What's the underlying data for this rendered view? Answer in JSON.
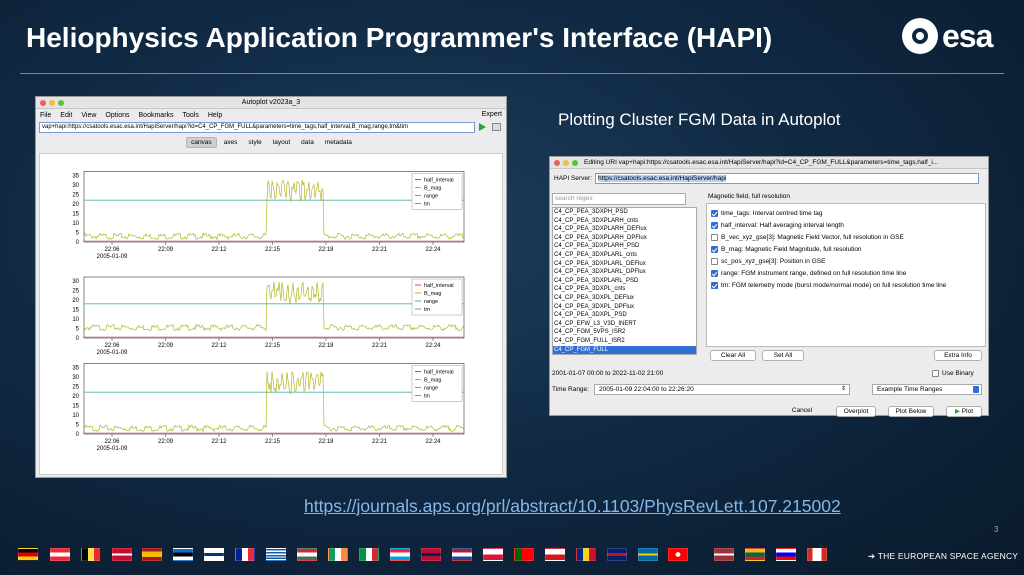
{
  "slide": {
    "title": "Heliophysics Application Programmer's Interface (HAPI)",
    "logo_text": "esa",
    "caption": "Plotting Cluster FGM Data in Autoplot",
    "link": "https://journals.aps.org/prl/abstract/10.1103/PhysRevLett.107.215002",
    "page_number": "3",
    "agency": "THE EUROPEAN SPACE AGENCY",
    "colors": {
      "background": "#0f2740",
      "link": "#86b7ea",
      "plot_line": "#b5b528",
      "plot_hline": "#48b4a8"
    }
  },
  "autoplot": {
    "window_title": "Autoplot v2023a_3",
    "menu": [
      "File",
      "Edit",
      "View",
      "Options",
      "Bookmarks",
      "Tools",
      "Help"
    ],
    "expert": "Expert",
    "url": "vap+hapi:https://csatools.esac.esa.int/HapiServer/hapi?id=C4_CP_FGM_FULL&parameters=time_tags,half_interval,B_mag,range,tm&tim",
    "tabs": [
      "canvas",
      "axes",
      "style",
      "layout",
      "data",
      "metadata"
    ],
    "active_tab": "canvas",
    "panels": [
      {
        "yticks": [
          "35",
          "30",
          "25",
          "20",
          "15",
          "10",
          "5",
          "0"
        ],
        "legend": [
          "half_interval",
          "B_mag",
          "range",
          "tm"
        ]
      },
      {
        "yticks": [
          "30",
          "25",
          "20",
          "15",
          "10",
          "5",
          "0"
        ],
        "legend": [
          "half_interval",
          "B_mag",
          "range",
          "tm"
        ]
      },
      {
        "yticks": [
          "35",
          "30",
          "25",
          "20",
          "15",
          "10",
          "5",
          "0"
        ],
        "legend": [
          "half_interval",
          "B_mag",
          "range",
          "tm"
        ]
      }
    ],
    "xticks": [
      "22:06",
      "22:09",
      "22:12",
      "22:15",
      "22:18",
      "22:21",
      "22:24"
    ],
    "date_label": "2005-01-09"
  },
  "editor": {
    "window_title": "Editing URI vap+hapi:https://csatools.esac.esa.int/HapiServer/hapi?id=C4_CP_FGM_FULL&parameters=time_tags,half_i...",
    "hapi_label": "HAPI Server:",
    "hapi_value": "https://csatools.esac.esa.int/HapiServer/hapi",
    "search_placeholder": "search regex",
    "datasets": [
      "C4_CP_PEA_3DXPH_PSD",
      "C4_CP_PEA_3DXPLARH_cnts",
      "C4_CP_PEA_3DXPLARH_DEFlux",
      "C4_CP_PEA_3DXPLARH_DPFlux",
      "C4_CP_PEA_3DXPLARH_PSD",
      "C4_CP_PEA_3DXPLARL_cnts",
      "C4_CP_PEA_3DXPLARL_DEFlux",
      "C4_CP_PEA_3DXPLARL_DPFlux",
      "C4_CP_PEA_3DXPLARL_PSD",
      "C4_CP_PEA_3DXPL_cnts",
      "C4_CP_PEA_3DXPL_DEFlux",
      "C4_CP_PEA_3DXPL_DPFlux",
      "C4_CP_PEA_3DXPL_PSD",
      "C4_CP_EFW_L3_V3D_INERT",
      "C4_CP_FGM_5VPS_ISR2",
      "C4_CP_FGM_FULL_ISR2",
      "C4_CP_FGM_FULL"
    ],
    "selected_dataset": "C4_CP_FGM_FULL",
    "param_title": "Magnetic field, full resolution",
    "params": [
      {
        "label": "time_tags: Interval centred time tag",
        "checked": true
      },
      {
        "label": "half_interval: Half averaging interval length",
        "checked": true
      },
      {
        "label": "B_vec_xyz_gse[3]: Magnetic Field Vector, full resolution in GSE",
        "checked": false
      },
      {
        "label": "B_mag: Magnetic Field Magnitude, full resolution",
        "checked": true
      },
      {
        "label": "sc_pos_xyz_gse[3]: Position in GSE",
        "checked": false
      },
      {
        "label": "range: FGM instrument range, defined on full resolution time line",
        "checked": true
      },
      {
        "label": "tm: FGM telemetry mode (burst mode/normal mode) on full resolution time line",
        "checked": true
      }
    ],
    "clear_all": "Clear All",
    "set_all": "Set All",
    "extra_info": "Extra Info",
    "available_range": "2001-01-07 00:00 to 2022-11-02 21:00",
    "use_binary": "Use Binary",
    "time_range_label": "Time Range:",
    "time_range_value": "2005-01-09 22:04:00 to 22:26:20",
    "example_ranges": "Example Time Ranges",
    "buttons": {
      "cancel": "Cancel",
      "overplot": "Overplot",
      "plot_below": "Plot Below",
      "plot": "Plot"
    }
  },
  "flags": [
    "de",
    "at",
    "be",
    "dk",
    "es",
    "ee",
    "fi",
    "fr",
    "gr",
    "hu",
    "ie",
    "it",
    "lu",
    "no",
    "nl",
    "pl",
    "pt",
    "cz",
    "ro",
    "gb",
    "se",
    "ch",
    "lv",
    "lt",
    "si",
    "ca"
  ]
}
